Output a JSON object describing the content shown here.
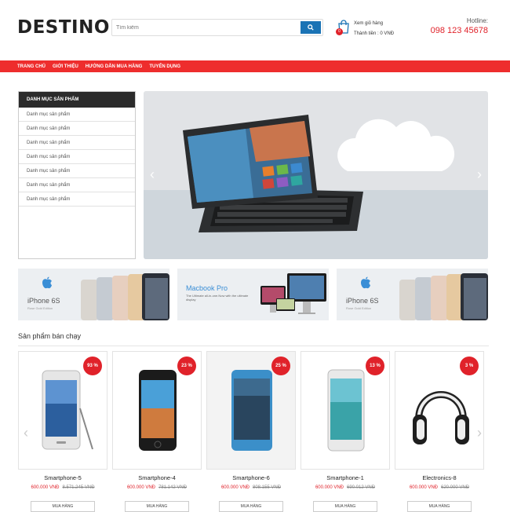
{
  "header": {
    "logo": "DESTINO",
    "search_placeholder": "Tìm kiếm",
    "cart": {
      "title": "Xem giỏ hàng",
      "count": "0",
      "total_label": "Thành tiền : ",
      "total_value": "0 VNĐ"
    },
    "hotline_label": "Hotline:",
    "hotline_number": "098 123 45678"
  },
  "nav": {
    "items": [
      "TRANG CHỦ",
      "GIỚI THIỆU",
      "HƯỚNG DẪN MUA HÀNG",
      "TUYỂN DỤNG"
    ]
  },
  "sidebar": {
    "title": "DANH MỤC SẢN PHẨM",
    "items": [
      "Danh mục sản phẩm",
      "Danh mục sản phẩm",
      "Danh mục sản phẩm",
      "Danh mục sản phẩm",
      "Danh mục sản phẩm",
      "Danh mục sản phẩm",
      "Danh mục sản phẩm"
    ]
  },
  "banners": [
    {
      "title": "iPhone 6S",
      "subtitle": "Rose Gold Edition"
    },
    {
      "title": "Macbook Pro",
      "subtitle": "The Ultimate all-in-one.Now with the ultimate display"
    },
    {
      "title": "iPhone 6S",
      "subtitle": "Rose Gold Edition"
    }
  ],
  "section": {
    "title": "Sản phẩm bán chạy"
  },
  "products": [
    {
      "name": "Smartphone-5",
      "discount": "93 %",
      "price": "600.000 VNĐ",
      "old_price": "8.571.245 VNĐ",
      "buy_label": "MUA HÀNG"
    },
    {
      "name": "Smartphone-4",
      "discount": "23 %",
      "price": "600.000 VNĐ",
      "old_price": "781.142 VNĐ",
      "buy_label": "MUA HÀNG"
    },
    {
      "name": "Smartphone-6",
      "discount": "25 %",
      "price": "600.000 VNĐ",
      "old_price": "808.155 VNĐ",
      "buy_label": "MUA HÀNG"
    },
    {
      "name": "Smartphone-1",
      "discount": "13 %",
      "price": "600.000 VNĐ",
      "old_price": "690.012 VNĐ",
      "buy_label": "MUA HÀNG"
    },
    {
      "name": "Electronics-8",
      "discount": "3 %",
      "price": "600.000 VNĐ",
      "old_price": "620.000 VNĐ",
      "buy_label": "MUA HÀNG"
    }
  ],
  "colors": {
    "accent_red": "#ee2d2d",
    "search_blue": "#1a73b5",
    "dark": "#2b2b2b"
  }
}
